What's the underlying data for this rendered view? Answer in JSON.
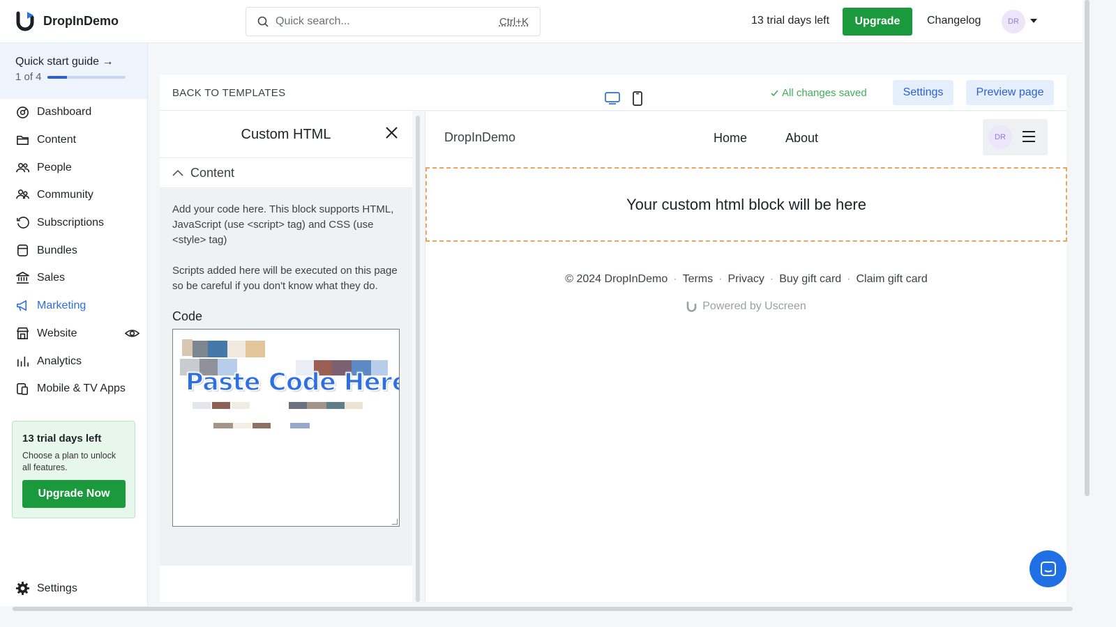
{
  "app": {
    "name": "DropInDemo"
  },
  "search": {
    "placeholder": "Quick search...",
    "shortcut": "Ctrl+K"
  },
  "topbar": {
    "trial": "13 trial days left",
    "upgrade": "Upgrade",
    "changelog": "Changelog",
    "avatar": "DR"
  },
  "quickstart": {
    "title": "Quick start guide →",
    "count": "1 of 4",
    "progress": 0.25
  },
  "nav": {
    "items": [
      {
        "label": "Dashboard",
        "icon": "dashboard-icon"
      },
      {
        "label": "Content",
        "icon": "folder-icon"
      },
      {
        "label": "People",
        "icon": "people-icon"
      },
      {
        "label": "Community",
        "icon": "community-icon"
      },
      {
        "label": "Subscriptions",
        "icon": "refresh-icon"
      },
      {
        "label": "Bundles",
        "icon": "bundle-icon"
      },
      {
        "label": "Sales",
        "icon": "bank-icon"
      },
      {
        "label": "Marketing",
        "icon": "megaphone-icon",
        "active": true
      },
      {
        "label": "Website",
        "icon": "store-icon"
      },
      {
        "label": "Analytics",
        "icon": "bar-chart-icon"
      },
      {
        "label": "Mobile & TV Apps",
        "icon": "devices-icon"
      }
    ],
    "settings": "Settings"
  },
  "trial_card": {
    "title": "13 trial days left",
    "text": "Choose a plan to unlock all features.",
    "button": "Upgrade Now"
  },
  "editor": {
    "back": "BACK TO TEMPLATES",
    "saved": "All changes saved",
    "settings": "Settings",
    "preview": "Preview page"
  },
  "panel": {
    "title": "Custom HTML",
    "section": "Content",
    "desc1": "Add your code here. This block supports HTML, JavaScript (use <script> tag) and CSS (use <style> tag)",
    "desc2": "Scripts added here will be executed on this page so be careful if you don't know what they do.",
    "code_label": "Code",
    "code_overlay": "Paste Code Here"
  },
  "site": {
    "brand": "DropInDemo",
    "links": [
      "Home",
      "About"
    ],
    "avatar": "DR",
    "block_text": "Your custom html block will be here",
    "footer": [
      "© 2024 DropInDemo",
      "Terms",
      "Privacy",
      "Buy gift card",
      "Claim gift card"
    ],
    "powered": "Powered by Uscreen"
  },
  "colors": {
    "accent": "#2b6fe0",
    "green": "#1a9a3c",
    "dash": "#e9a65a"
  }
}
